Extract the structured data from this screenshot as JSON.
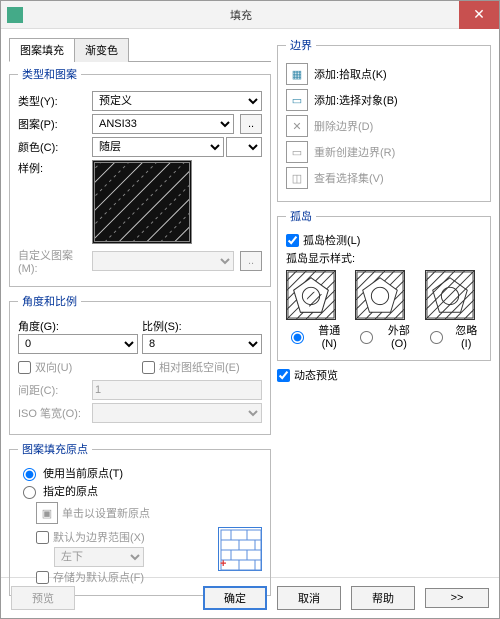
{
  "window": {
    "title": "填充"
  },
  "tabs": {
    "hatch": "图案填充",
    "gradient": "渐变色"
  },
  "left": {
    "grp_type": "类型和图案",
    "type_label": "类型(Y):",
    "type_value": "预定义",
    "pattern_label": "图案(P):",
    "pattern_value": "ANSI33",
    "color_label": "颜色(C):",
    "color_value": "随层",
    "sample_label": "样例:",
    "custom_label": "自定义图案(M):",
    "grp_angle": "角度和比例",
    "angle_label": "角度(G):",
    "angle_value": "0",
    "scale_label": "比例(S):",
    "scale_value": "8",
    "double_label": "双向(U)",
    "paperspace_label": "相对图纸空间(E)",
    "spacing_label": "间距(C):",
    "spacing_value": "1",
    "isowidth_label": "ISO 笔宽(O):",
    "grp_origin": "图案填充原点",
    "use_current": "使用当前原点(T)",
    "specified": "指定的原点",
    "click_set": "单击以设置新原点",
    "default_extent": "默认为边界范围(X)",
    "extent_pos": "左下",
    "store_default": "存储为默认原点(F)"
  },
  "right": {
    "grp_boundary": "边界",
    "add_pick": "添加:拾取点(K)",
    "add_select": "添加:选择对象(B)",
    "remove_boundary": "删除边界(D)",
    "recreate_boundary": "重新创建边界(R)",
    "view_selection": "查看选择集(V)",
    "grp_island": "孤岛",
    "island_detect": "孤岛检测(L)",
    "island_style": "孤岛显示样式:",
    "isl_normal": "普通(N)",
    "isl_outer": "外部(O)",
    "isl_ignore": "忽略(I)",
    "dyn_preview": "动态预览"
  },
  "footer": {
    "preview": "预览",
    "ok": "确定",
    "cancel": "取消",
    "help": "帮助",
    "expand": ">>"
  }
}
